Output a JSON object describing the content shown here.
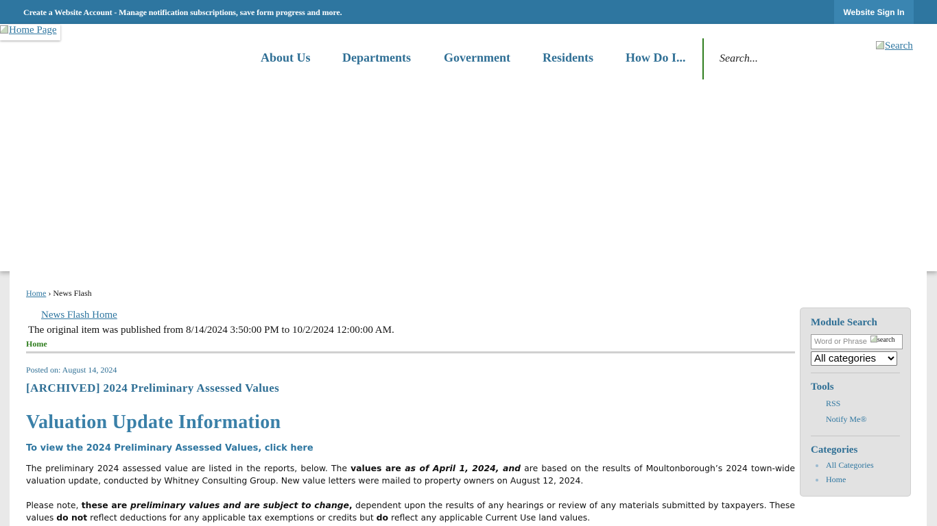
{
  "topbar": {
    "account_text": "Create a Website Account - Manage notification subscriptions, save form progress and more.",
    "signin_label": "Website Sign In",
    "bg_color": "#2e76a0"
  },
  "header": {
    "logo_alt": "Home Page",
    "nav": [
      "About Us",
      "Departments",
      "Government",
      "Residents",
      "How Do I..."
    ],
    "search_placeholder": "Search...",
    "search_button_alt": "Search",
    "divider_color": "#2e7d1d"
  },
  "breadcrumb": {
    "home": "Home",
    "separator": "›",
    "current": "News Flash"
  },
  "newsflash": {
    "home_link": "News Flash Home",
    "original_note": "The original item was published from 8/14/2024 3:50:00 PM to 10/2/2024 12:00:00 AM.",
    "tab_label": "Home",
    "posted": "Posted on: August 14, 2024",
    "archived_title": "[ARCHIVED] 2024 Preliminary Assessed Values",
    "heading": "Valuation Update Information",
    "view_link": "To view the 2024 Preliminary Assessed Values, click here",
    "p1": {
      "a": "The preliminary 2024 assessed value are listed in the reports, below. The ",
      "b": "values are ",
      "c": "as of April 1, 2024, and",
      "d": " are based on the results of Moultonborough’s 2024 town-wide valuation update, conducted by Whitney Consulting Group. New value letters were mailed to property owners on August 12, 2024."
    },
    "p2": {
      "a": "Please note, ",
      "b": "these are ",
      "c": "preliminary values and are subject to change",
      "d": ",",
      "e": " dependent upon the results of any hearings or review of any materials submitted by taxpayers. These values ",
      "f": "do not",
      "g": " reflect deductions for any applicable tax exemptions or credits but ",
      "h": "do",
      "i": " reflect any applicable Current Use land values."
    }
  },
  "sidebar": {
    "module_search_heading": "Module Search",
    "search_placeholder": "Word or Phrase",
    "search_button_alt": "search",
    "category_selected": "All categories",
    "tools_heading": "Tools",
    "tools": [
      "RSS",
      "Notify Me®"
    ],
    "categories_heading": "Categories",
    "categories": [
      "All Categories",
      "Home"
    ]
  },
  "colors": {
    "link": "#2e76a0",
    "heading": "#2f6f95",
    "accent_green": "#2e7d1d"
  }
}
